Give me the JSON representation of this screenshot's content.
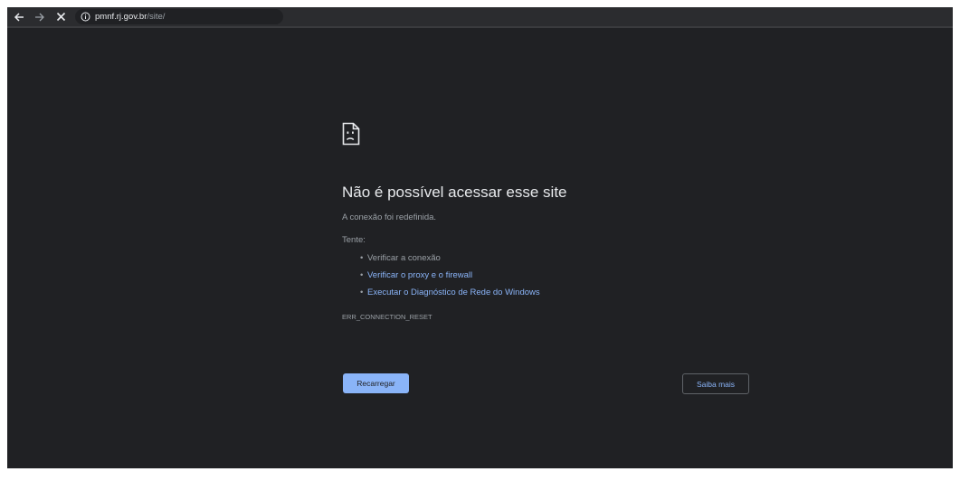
{
  "browser": {
    "url_host": "pmnf.rj.gov.br",
    "url_path": "/site/",
    "icons": {
      "back": "arrow-left-icon",
      "forward": "arrow-right-icon",
      "stop": "close-icon",
      "info": "info-icon"
    }
  },
  "error_page": {
    "icon": "sad-page-icon",
    "title": "Não é possível acessar esse site",
    "subtitle": "A conexão foi redefinida.",
    "try_label": "Tente:",
    "suggestions": [
      "Verificar a conexão",
      "Verificar o proxy e o firewall",
      "Executar o Diagnóstico de Rede do Windows"
    ],
    "error_code": "ERR_CONNECTION_RESET",
    "reload_label": "Recarregar",
    "learn_more_label": "Saiba mais"
  },
  "colors": {
    "background": "#202124",
    "accent": "#8ab4f8",
    "text_primary": "#e8eaed",
    "text_secondary": "#9aa0a6"
  }
}
